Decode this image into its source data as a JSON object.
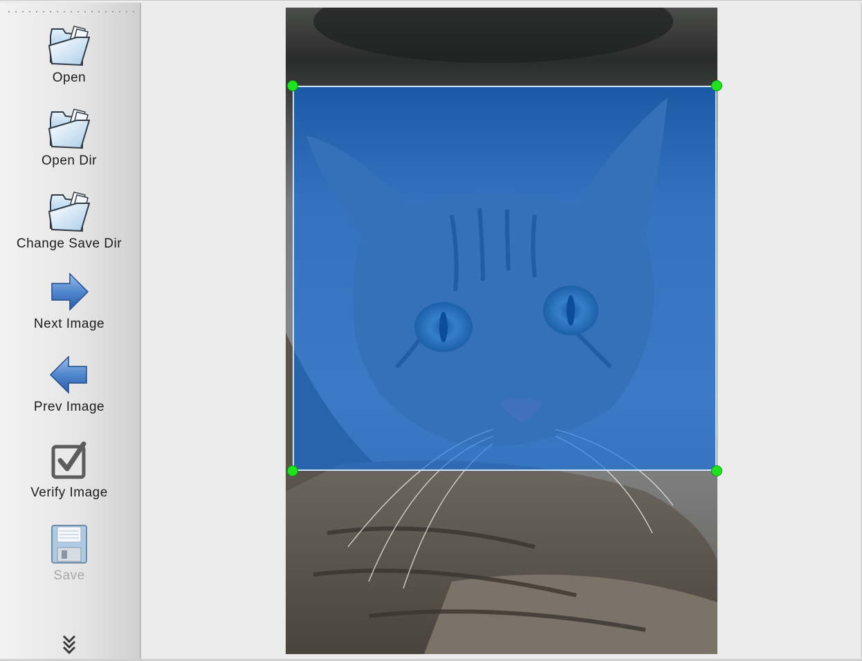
{
  "toolbar": {
    "items": [
      {
        "label": "Open",
        "icon": "folder-open-icon",
        "enabled": true
      },
      {
        "label": "Open Dir",
        "icon": "folder-open-icon",
        "enabled": true
      },
      {
        "label": "Change Save Dir",
        "icon": "folder-open-icon",
        "enabled": true
      },
      {
        "label": "Next Image",
        "icon": "arrow-right-icon",
        "enabled": true
      },
      {
        "label": "Prev Image",
        "icon": "arrow-left-icon",
        "enabled": true
      },
      {
        "label": "Verify Image",
        "icon": "checkbox-checked-icon",
        "enabled": true
      },
      {
        "label": "Save",
        "icon": "floppy-disk-icon",
        "enabled": false
      }
    ],
    "overflow_icon": "double-chevron-down-icon"
  },
  "canvas": {
    "image_subject": "tabby cat",
    "annotation": {
      "shape": "rectangle",
      "fill_color": "#0a6ee6",
      "handle_color": "#1ee31e"
    }
  }
}
